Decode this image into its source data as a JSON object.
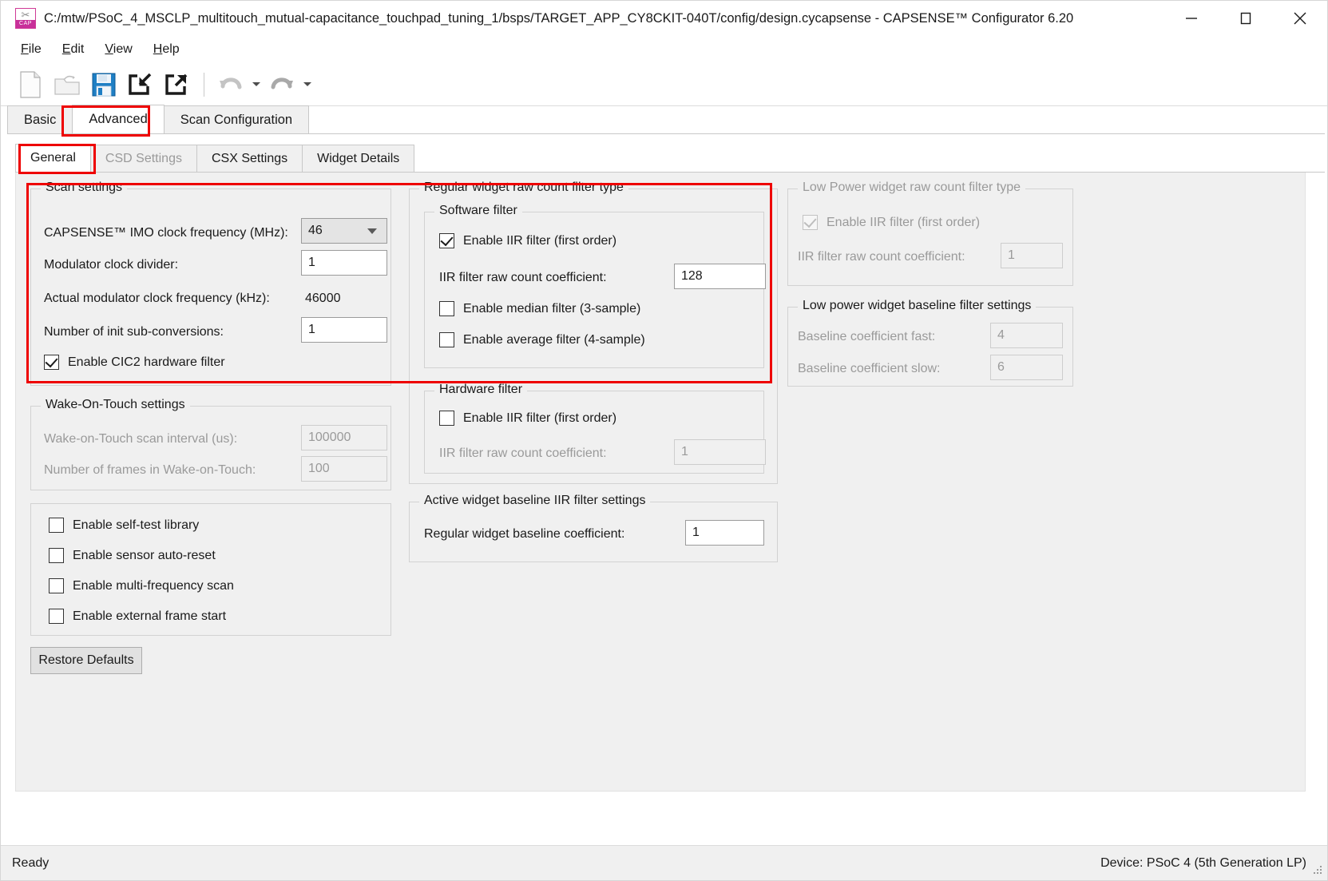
{
  "window": {
    "title": "C:/mtw/PSoC_4_MSCLP_multitouch_mutual-capacitance_touchpad_tuning_1/bsps/TARGET_APP_CY8CKIT-040T/config/design.cycapsense - CAPSENSE™ Configurator 6.20",
    "app_icon": "capsense-icon",
    "icon_badge": "CAP",
    "minimize": "minimize-icon",
    "maximize": "maximize-icon",
    "close": "close-icon"
  },
  "menu": {
    "items": [
      {
        "label": "File",
        "mnemonic": "F"
      },
      {
        "label": "Edit",
        "mnemonic": "E"
      },
      {
        "label": "View",
        "mnemonic": "V"
      },
      {
        "label": "Help",
        "mnemonic": "H"
      }
    ]
  },
  "toolbar": {
    "buttons": [
      {
        "name": "new-file-icon",
        "enabled": true
      },
      {
        "name": "open-folder-icon",
        "enabled": false
      },
      {
        "name": "save-icon",
        "enabled": true
      },
      {
        "name": "import-icon",
        "enabled": true
      },
      {
        "name": "export-icon",
        "enabled": true
      },
      {
        "name": "undo-icon",
        "enabled": false
      },
      {
        "name": "redo-icon",
        "enabled": true
      }
    ]
  },
  "tabs_outer": {
    "items": [
      {
        "label": "Basic",
        "active": false,
        "highlighted": false
      },
      {
        "label": "Advanced",
        "active": true,
        "highlighted": true
      },
      {
        "label": "Scan Configuration",
        "active": false,
        "highlighted": false
      }
    ]
  },
  "tabs_inner": {
    "items": [
      {
        "label": "General",
        "active": true,
        "disabled": false,
        "highlighted": true
      },
      {
        "label": "CSD Settings",
        "active": false,
        "disabled": true,
        "highlighted": false
      },
      {
        "label": "CSX Settings",
        "active": false,
        "disabled": false,
        "highlighted": false
      },
      {
        "label": "Widget Details",
        "active": false,
        "disabled": false,
        "highlighted": false
      }
    ]
  },
  "scan_settings": {
    "title": "Scan settings",
    "imo_label": "CAPSENSE™ IMO clock frequency (MHz):",
    "imo_value": "46",
    "mod_div_label": "Modulator clock divider:",
    "mod_div_value": "1",
    "actual_label": "Actual modulator clock frequency (kHz):",
    "actual_value": "46000",
    "init_sub_label": "Number of init sub-conversions:",
    "init_sub_value": "1",
    "cic2_label": "Enable CIC2 hardware filter",
    "cic2_checked": true
  },
  "wake_on_touch": {
    "title": "Wake-On-Touch settings",
    "interval_label": "Wake-on-Touch scan interval (us):",
    "interval_value": "100000",
    "frames_label": "Number of frames in Wake-on-Touch:",
    "frames_value": "100"
  },
  "misc_options": {
    "items": [
      {
        "label": "Enable self-test library",
        "checked": false
      },
      {
        "label": "Enable sensor auto-reset",
        "checked": false
      },
      {
        "label": "Enable multi-frequency scan",
        "checked": false
      },
      {
        "label": "Enable external frame start",
        "checked": false
      }
    ]
  },
  "restore_defaults": {
    "label": "Restore Defaults"
  },
  "regular_filter": {
    "title": "Regular widget raw count filter type",
    "software": {
      "title": "Software filter",
      "iir_label": "Enable IIR filter (first order)",
      "iir_checked": true,
      "coeff_label": "IIR filter raw count coefficient:",
      "coeff_value": "128",
      "median_label": "Enable median filter (3-sample)",
      "median_checked": false,
      "average_label": "Enable average filter (4-sample)",
      "average_checked": false
    },
    "hardware": {
      "title": "Hardware filter",
      "iir_label": "Enable IIR filter (first order)",
      "iir_checked": false,
      "coeff_label": "IIR filter raw count coefficient:",
      "coeff_value": "1"
    }
  },
  "active_baseline": {
    "title": "Active widget baseline IIR filter settings",
    "coeff_label": "Regular widget baseline coefficient:",
    "coeff_value": "1"
  },
  "low_power_filter": {
    "title": "Low Power widget raw count filter type",
    "iir_label": "Enable IIR filter (first order)",
    "iir_checked": true,
    "coeff_label": "IIR filter raw count coefficient:",
    "coeff_value": "1"
  },
  "low_power_baseline": {
    "title": "Low power widget baseline filter settings",
    "fast_label": "Baseline coefficient fast:",
    "fast_value": "4",
    "slow_label": "Baseline coefficient slow:",
    "slow_value": "6"
  },
  "statusbar": {
    "status": "Ready",
    "device": "Device: PSoC 4 (5th Generation LP)"
  },
  "colors": {
    "annotation_red": "#ee0000",
    "panel_bg": "#f0f0f0",
    "accent_magenta": "#c8309a"
  }
}
